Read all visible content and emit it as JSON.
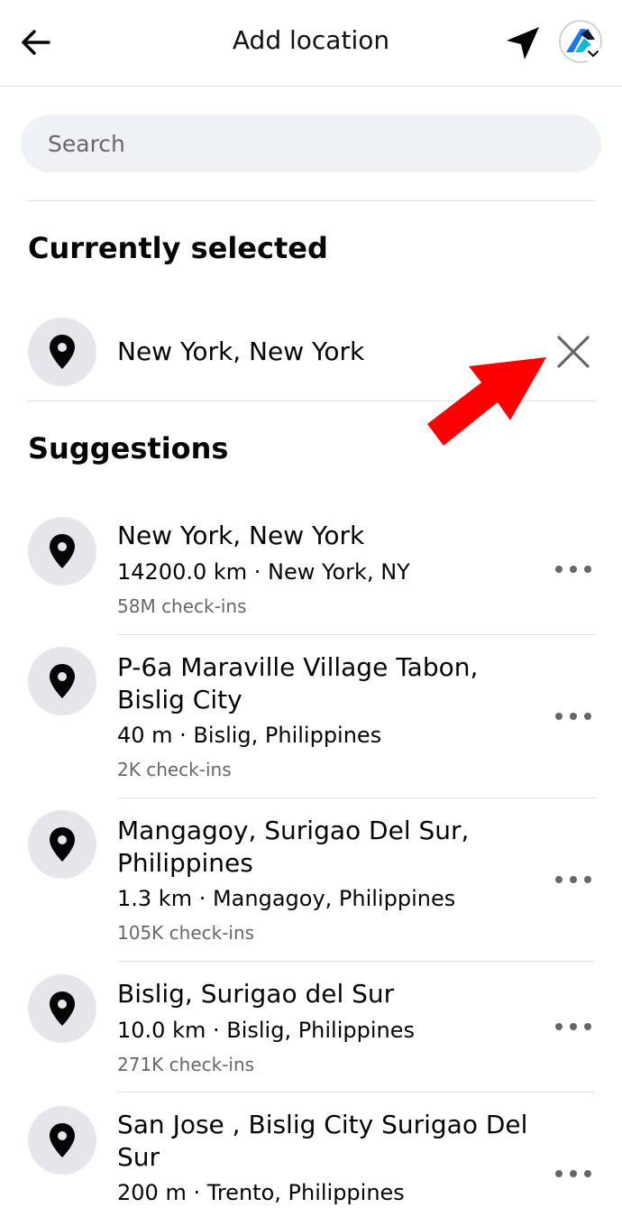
{
  "header": {
    "title": "Add location",
    "back_icon": "arrow-left-icon",
    "locate_icon": "navigation-arrow-icon",
    "avatar_icon": "profile-avatar-icon"
  },
  "search": {
    "placeholder": "Search"
  },
  "current": {
    "section_title": "Currently selected",
    "name": "New York, New York",
    "clear_icon": "close-icon"
  },
  "suggestions": {
    "section_title": "Suggestions",
    "items": [
      {
        "name": "New York, New York",
        "meta": "14200.0 km · New York, NY",
        "checkins": "58M check-ins"
      },
      {
        "name": "P-6a Maraville Village Tabon, Bislig City",
        "meta": "40 m · Bislig, Philippines",
        "checkins": "2K check-ins"
      },
      {
        "name": "Mangagoy, Surigao Del Sur, Philippines",
        "meta": "1.3 km · Mangagoy, Philippines",
        "checkins": "105K check-ins"
      },
      {
        "name": "Bislig, Surigao del Sur",
        "meta": "10.0 km · Bislig, Philippines",
        "checkins": "271K check-ins"
      },
      {
        "name": "San Jose , Bislig City Surigao Del Sur",
        "meta": "200 m · Trento, Philippines",
        "checkins": ""
      }
    ]
  },
  "colors": {
    "annotation_arrow": "#ff0000",
    "pin_background": "#e4e6eb",
    "search_background": "#eff2f5"
  }
}
